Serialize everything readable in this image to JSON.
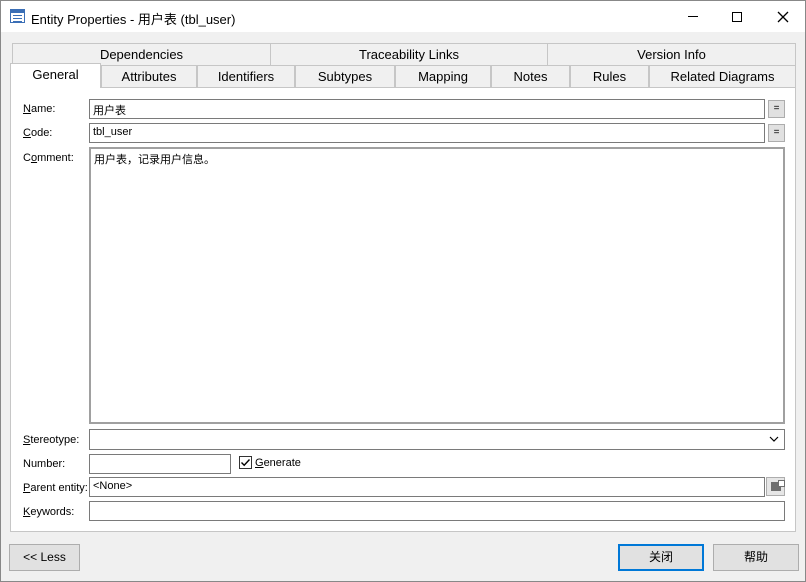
{
  "window": {
    "title": "Entity Properties - 用户表 (tbl_user)",
    "icon": "entity-properties-icon"
  },
  "tabs": {
    "row1": [
      {
        "label": "Dependencies"
      },
      {
        "label": "Traceability Links"
      },
      {
        "label": "Version Info"
      }
    ],
    "row2": [
      {
        "label": "General",
        "active": true
      },
      {
        "label": "Attributes"
      },
      {
        "label": "Identifiers"
      },
      {
        "label": "Subtypes"
      },
      {
        "label": "Mapping"
      },
      {
        "label": "Notes"
      },
      {
        "label": "Rules"
      },
      {
        "label": "Related Diagrams"
      }
    ]
  },
  "form": {
    "name_label_key": "N",
    "name_label_rest": "ame:",
    "name_value": "用户表",
    "code_label_key": "C",
    "code_label_rest": "ode:",
    "code_value": "tbl_user",
    "comment_label_pre": "C",
    "comment_label_key": "o",
    "comment_label_rest": "mment:",
    "comment_value": "用户表，记录用户信息。",
    "stereotype_label_key": "S",
    "stereotype_label_rest": "tereotype:",
    "stereotype_value": "",
    "number_label": "Number:",
    "number_value": "",
    "generate_label_key": "G",
    "generate_label_rest": "enerate",
    "generate_checked": true,
    "parent_label_key": "P",
    "parent_label_rest": "arent entity:",
    "parent_value": "<None>",
    "keywords_label_key": "K",
    "keywords_label_rest": "eywords:",
    "keywords_value": "",
    "eq_symbol": "="
  },
  "buttons": {
    "less": "<< Less",
    "close": "关闭",
    "help": "帮助"
  }
}
